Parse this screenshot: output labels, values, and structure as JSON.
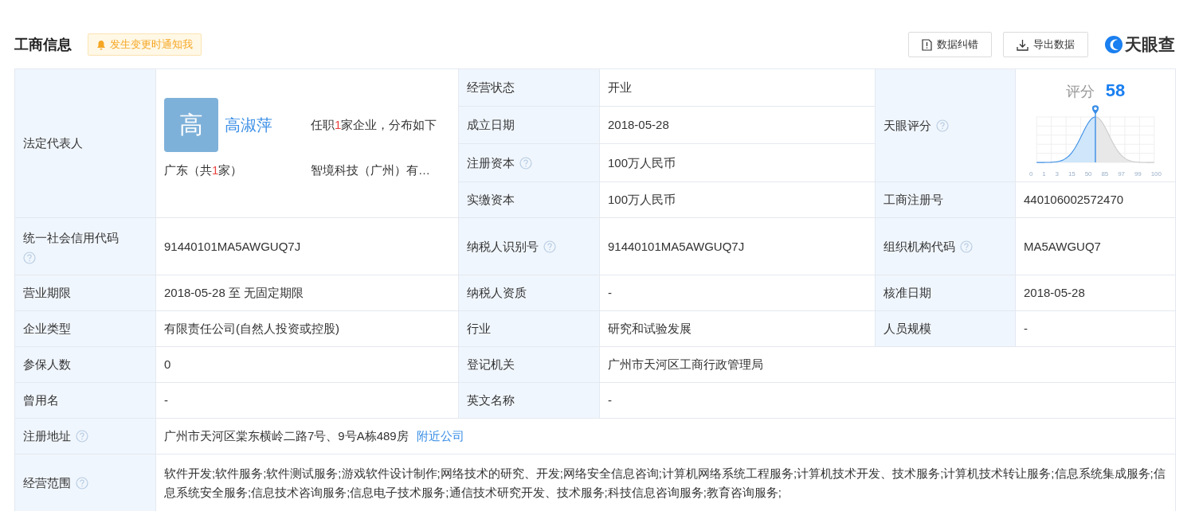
{
  "header": {
    "title": "工商信息",
    "notify": "发生变更时通知我",
    "buttons": [
      {
        "kind": "report",
        "label": "数据纠错"
      },
      {
        "kind": "export",
        "label": "导出数据"
      }
    ],
    "logo": "天眼查"
  },
  "legal_rep": {
    "label": "法定代表人",
    "avatar": "高",
    "name": "高淑萍",
    "summary": {
      "before": "任职",
      "count": "1",
      "after": "家企业，分布如下"
    },
    "region": {
      "before": "广东（共",
      "count": "1",
      "after": "家）"
    },
    "company": "智境科技（广州）有…"
  },
  "status_fields": [
    {
      "label": "经营状态",
      "help": false,
      "value": "开业"
    },
    {
      "label": "成立日期",
      "help": false,
      "value": "2018-05-28"
    },
    {
      "label": "注册资本",
      "help": true,
      "value": "100万人民币"
    },
    {
      "label": "实缴资本",
      "help": false,
      "value": "100万人民币"
    }
  ],
  "score": {
    "label": "天眼评分",
    "help": true,
    "title": "评分",
    "value": "58",
    "scale": [
      "0",
      "1",
      "3",
      "15",
      "50",
      "85",
      "97",
      "99",
      "100"
    ]
  },
  "reg_no": {
    "label": "工商注册号",
    "value": "440106002572470"
  },
  "rows": [
    [
      {
        "label": "统一社会信用代码",
        "help": true,
        "value": "91440101MA5AWGUQ7J"
      },
      {
        "label": "纳税人识别号",
        "help": true,
        "value": "91440101MA5AWGUQ7J"
      },
      {
        "label": "组织机构代码",
        "help": true,
        "value": "MA5AWGUQ7"
      }
    ],
    [
      {
        "label": "营业期限",
        "help": false,
        "value": "2018-05-28 至 无固定期限"
      },
      {
        "label": "纳税人资质",
        "help": false,
        "value": "-"
      },
      {
        "label": "核准日期",
        "help": false,
        "value": "2018-05-28"
      }
    ],
    [
      {
        "label": "企业类型",
        "help": false,
        "value": "有限责任公司(自然人投资或控股)"
      },
      {
        "label": "行业",
        "help": false,
        "value": "研究和试验发展"
      },
      {
        "label": "人员规模",
        "help": false,
        "value": "-"
      }
    ],
    [
      {
        "label": "参保人数",
        "help": false,
        "value": "0"
      },
      {
        "label": "登记机关",
        "help": false,
        "value": "广州市天河区工商行政管理局"
      }
    ],
    [
      {
        "label": "曾用名",
        "help": false,
        "value": "-"
      },
      {
        "label": "英文名称",
        "help": false,
        "value": "-"
      }
    ],
    [
      {
        "label": "注册地址",
        "help": true,
        "value": "广州市天河区棠东横岭二路7号、9号A栋489房",
        "link": "附近公司"
      }
    ],
    [
      {
        "label": "经营范围",
        "help": true,
        "value": "软件开发;软件服务;软件测试服务;游戏软件设计制作;网络技术的研究、开发;网络安全信息咨询;计算机网络系统工程服务;计算机技术开发、技术服务;计算机技术转让服务;信息系统集成服务;信息系统安全服务;信息技术咨询服务;信息电子技术服务;通信技术研究开发、技术服务;科技信息咨询服务;教育咨询服务;"
      }
    ]
  ]
}
